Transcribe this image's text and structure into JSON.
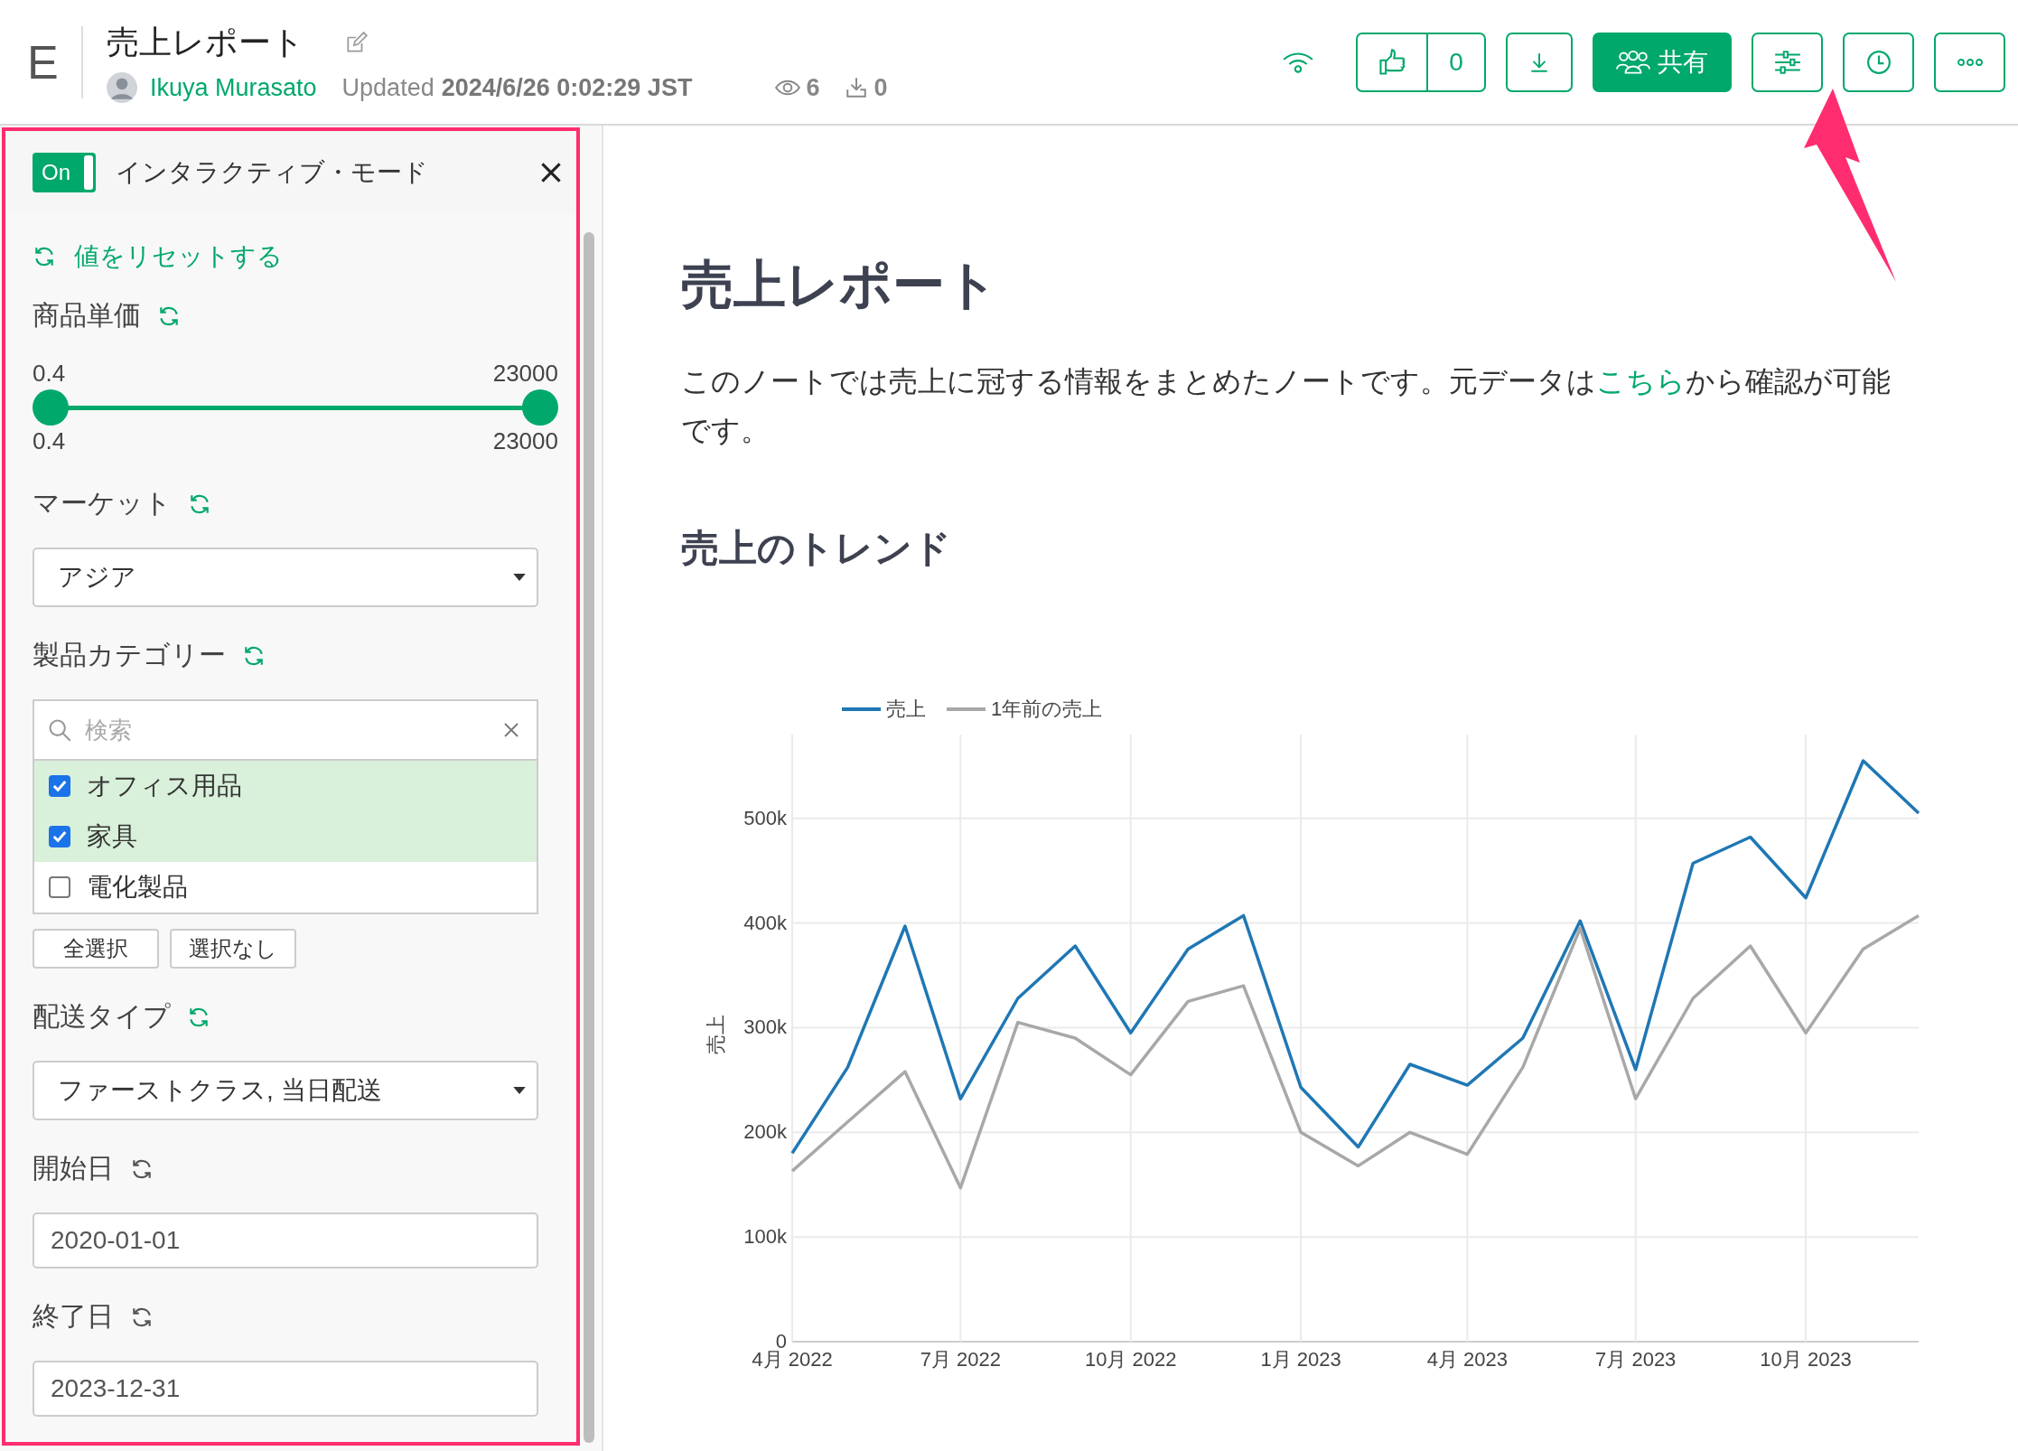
{
  "header": {
    "logo": "E",
    "title": "売上レポート",
    "author": "Ikuya Murasato",
    "updated_label": "Updated",
    "updated_at": "2024/6/26 0:02:29 JST",
    "views": "6",
    "downloads": "0",
    "like_count": "0",
    "share_label": "共有"
  },
  "sidebar": {
    "toggle": {
      "label": "On",
      "on": true
    },
    "title": "インタラクティブ・モード",
    "reset_link": "値をリセットする",
    "filters": [
      {
        "kind": "range",
        "label": "商品単価",
        "modified": true,
        "min_label": "0.4",
        "max_label": "23000",
        "low": "0.4",
        "high": "23000",
        "thumbs": [
          {
            "level": 0
          },
          {
            "level": 1
          }
        ]
      },
      {
        "kind": "select",
        "label": "マーケット",
        "modified": true,
        "value": "アジア"
      },
      {
        "kind": "checklist",
        "label": "製品カテゴリー",
        "modified": true,
        "placeholder": "検索",
        "items": [
          {
            "label": "オフィス用品",
            "checked": true
          },
          {
            "label": "家具",
            "checked": true
          },
          {
            "label": "電化製品",
            "checked": false
          }
        ],
        "buttons": [
          "全選択",
          "選択なし"
        ]
      },
      {
        "kind": "select",
        "label": "配送タイプ",
        "modified": true,
        "value": "ファーストクラス, 当日配送"
      },
      {
        "kind": "date",
        "label": "開始日",
        "modified": false,
        "value": "2020-01-01"
      },
      {
        "kind": "date",
        "label": "終了日",
        "modified": false,
        "value": "2023-12-31"
      }
    ]
  },
  "main": {
    "heading": "売上レポート",
    "intro": {
      "before": "このノートでは売上に冠する情報をまとめたノートです。元データは",
      "link": "こちら",
      "after": "から確認が可能です。"
    },
    "subheading": "売上のトレンド",
    "chart_data": {
      "type": "line",
      "ylabel": "売上",
      "x": [
        "2022-04",
        "2022-05",
        "2022-06",
        "2022-07",
        "2022-08",
        "2022-09",
        "2022-10",
        "2022-11",
        "2022-12",
        "2023-01",
        "2023-02",
        "2023-03",
        "2023-04",
        "2023-05",
        "2023-06",
        "2023-07",
        "2023-08",
        "2023-09",
        "2023-10",
        "2023-11",
        "2023-12"
      ],
      "series": [
        {
          "name": "売上",
          "color": "#1f77b4",
          "values": [
            180000,
            262000,
            397000,
            232000,
            328000,
            378000,
            295000,
            375000,
            407000,
            243000,
            186000,
            265000,
            245000,
            290000,
            402000,
            260000,
            457000,
            482000,
            424000,
            555000,
            505000
          ]
        },
        {
          "name": "1年前の売上",
          "color": "#a8a8a8",
          "values": [
            163000,
            210000,
            258000,
            147000,
            305000,
            290000,
            255000,
            325000,
            340000,
            200000,
            168000,
            200000,
            179000,
            262000,
            395000,
            232000,
            328000,
            378000,
            295000,
            375000,
            407000
          ]
        }
      ],
      "xlim": [
        "2022-04",
        "2023-12"
      ],
      "grid": true,
      "legend": true,
      "ylim": [
        0,
        580000
      ],
      "yticks": [
        {
          "value": 0,
          "label": "0"
        },
        {
          "value": 100000,
          "label": "100k"
        },
        {
          "value": 200000,
          "label": "200k"
        },
        {
          "value": 300000,
          "label": "300k"
        },
        {
          "value": 400000,
          "label": "400k"
        },
        {
          "value": 500000,
          "label": "500k"
        }
      ],
      "xticks": [
        {
          "value": "2022-04",
          "label": "4月 2022"
        },
        {
          "value": "2022-07",
          "label": "7月 2022"
        },
        {
          "value": "2022-10",
          "label": "10月 2022"
        },
        {
          "value": "2023-01",
          "label": "1月 2023"
        },
        {
          "value": "2023-04",
          "label": "4月 2023"
        },
        {
          "value": "2023-07",
          "label": "7月 2023"
        },
        {
          "value": "2023-10",
          "label": "10月 2023"
        }
      ]
    }
  }
}
